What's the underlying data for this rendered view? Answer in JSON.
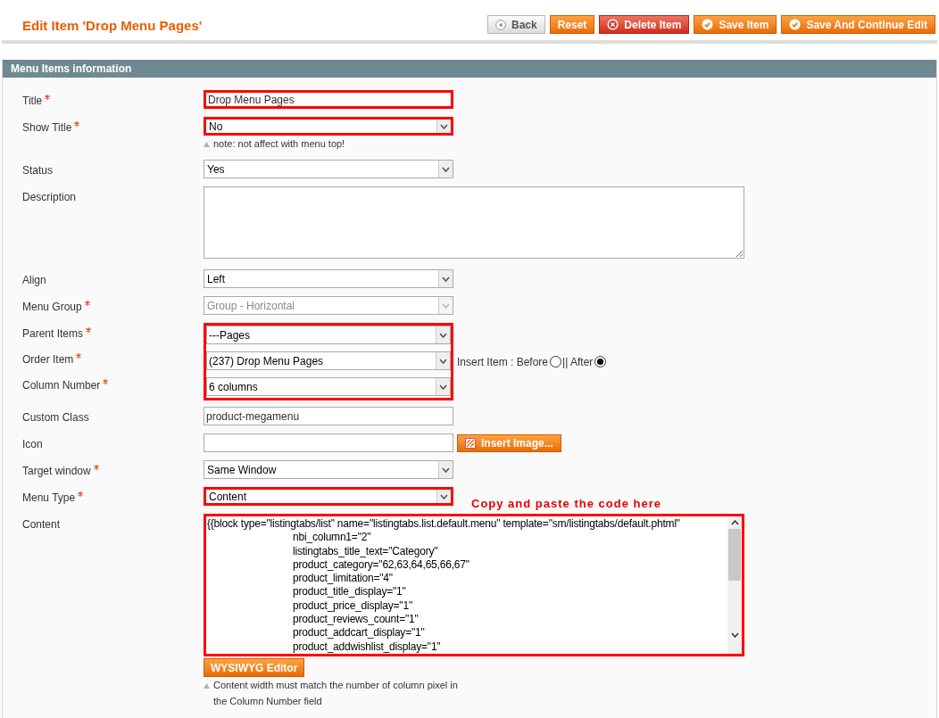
{
  "page_title": "Edit Item 'Drop Menu Pages'",
  "buttons": [
    {
      "label": "Back",
      "kind": "back"
    },
    {
      "label": "Reset",
      "kind": "plain"
    },
    {
      "label": "Delete Item",
      "kind": "delete"
    },
    {
      "label": "Save Item",
      "kind": "save"
    },
    {
      "label": "Save And Continue Edit",
      "kind": "save"
    }
  ],
  "section_title": "Menu Items information",
  "fields": [
    {
      "label": "Title",
      "required": true,
      "kind": "text",
      "value": "Drop Menu Pages",
      "highlighted": true
    },
    {
      "label": "Show Title",
      "required": true,
      "kind": "select",
      "value": "No",
      "highlighted": true,
      "note": "note: not affect with menu top!"
    },
    {
      "label": "Status",
      "required": false,
      "kind": "select",
      "value": "Yes",
      "highlighted": false
    },
    {
      "label": "Description",
      "required": false,
      "kind": "textarea",
      "highlighted": false
    },
    {
      "label": "Align",
      "required": false,
      "kind": "select",
      "value": "Left",
      "highlighted": false
    },
    {
      "label": "Menu Group",
      "required": true,
      "kind": "select",
      "value": "Group - Horizontal",
      "disabled": true,
      "highlighted": false
    },
    {
      "label": "Parent Items",
      "required": true,
      "kind": "select",
      "value": "---Pages",
      "highlighted": true
    },
    {
      "label": "Order Item",
      "required": true,
      "kind": "select",
      "value": "(237) Drop Menu Pages",
      "highlighted": true,
      "radios": [
        {
          "label": "Insert Item : Before",
          "selected": false
        },
        {
          "label": "|| After",
          "selected": true
        }
      ]
    },
    {
      "label": "Column Number",
      "required": true,
      "kind": "select",
      "value": "6 columns",
      "highlighted": true
    },
    {
      "label": "Custom Class",
      "required": false,
      "kind": "text",
      "value": "product-megamenu",
      "highlighted": false
    },
    {
      "label": "Icon",
      "required": false,
      "kind": "image",
      "button": "Insert Image...",
      "highlighted": false
    },
    {
      "label": "Target window",
      "required": true,
      "kind": "select",
      "value": "Same Window",
      "highlighted": false
    },
    {
      "label": "Menu Type",
      "required": true,
      "kind": "select",
      "value": "Content",
      "highlighted": true
    },
    {
      "label": "Content",
      "required": false,
      "kind": "code",
      "highlighted": true,
      "annotation": "Copy and paste the code here",
      "button": "WYSIWYG Editor",
      "note": "Content width must match the number of column pixel in the Column Number field",
      "lines": [
        {
          "text": "{{block type=\"listingtabs/list\" name=\"listingtabs.list.default.menu\" template=\"sm/listingtabs/default.phtml\"",
          "children": [
            {
              "text": "nbi_column1=\"2\""
            },
            {
              "text": "listingtabs_title_text=\"Category\""
            },
            {
              "text": "product_category=\"62,63,64,65,66,67\""
            },
            {
              "text": "product_limitation=\"4\""
            },
            {
              "text": "product_title_display=\"1\""
            },
            {
              "text": "product_price_display=\"1\""
            },
            {
              "text": "product_reviews_count=\"1\""
            },
            {
              "text": "product_addcart_display=\"1\""
            },
            {
              "text": "product_addwishlist_display=\"1\""
            }
          ]
        }
      ]
    }
  ]
}
